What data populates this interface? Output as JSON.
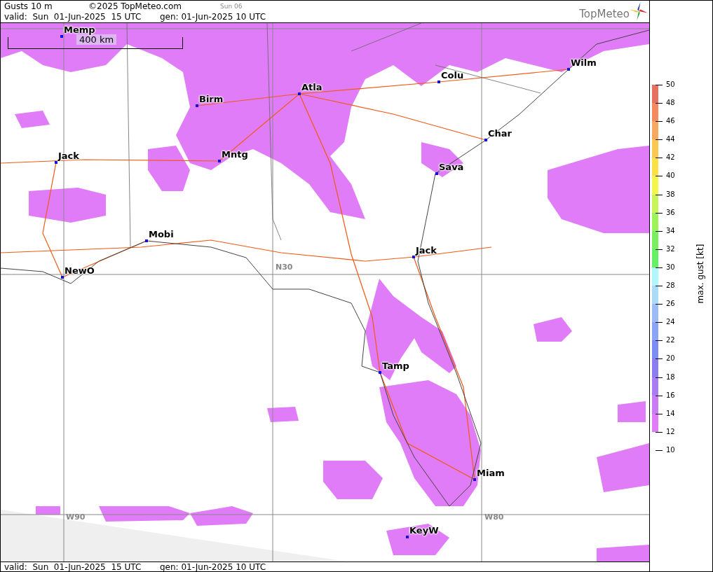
{
  "header": {
    "title": "Gusts 10 m",
    "copyright": "©2025 TopMeteo.com",
    "day": "Sun 06",
    "valid": "valid:  Sun  01-Jun-2025  15 UTC",
    "generated": "gen: 01-Jun-2025 10 UTC",
    "logo": "TopMeteo"
  },
  "map": {
    "scale": "400 km",
    "grid_labels": [
      "N30",
      "W90",
      "W80"
    ],
    "cities": [
      {
        "label": "Memp"
      },
      {
        "label": "Birm"
      },
      {
        "label": "Atla"
      },
      {
        "label": "Colu"
      },
      {
        "label": "Wilm"
      },
      {
        "label": "Char"
      },
      {
        "label": "Mntg"
      },
      {
        "label": "Jack"
      },
      {
        "label": "Sava"
      },
      {
        "label": "Mobi"
      },
      {
        "label": "Jack"
      },
      {
        "label": "NewO"
      },
      {
        "label": "Tamp"
      },
      {
        "label": "Miam"
      },
      {
        "label": "KeyW"
      }
    ]
  },
  "footer": {
    "valid": "valid:  Sun  01-Jun-2025  15 UTC",
    "generated": "gen: 01-Jun-2025 10 UTC"
  },
  "legend": {
    "title": "max. gust [kt]",
    "ticks": [
      "50",
      "48",
      "46",
      "44",
      "42",
      "40",
      "38",
      "36",
      "34",
      "32",
      "30",
      "28",
      "26",
      "24",
      "22",
      "20",
      "18",
      "16",
      "14",
      "12",
      "10"
    ],
    "bands": [
      {
        "color": "#e87060"
      },
      {
        "color": "#f58a60"
      },
      {
        "color": "#f8a860"
      },
      {
        "color": "#fbc850"
      },
      {
        "color": "#fbe048"
      },
      {
        "color": "#f5f550"
      },
      {
        "color": "#c8f55a"
      },
      {
        "color": "#9ef25a"
      },
      {
        "color": "#7af060"
      },
      {
        "color": "#66f066"
      },
      {
        "color": "#b0f8fb"
      },
      {
        "color": "#a8dcf9"
      },
      {
        "color": "#9dbcf7"
      },
      {
        "color": "#8aa5f6"
      },
      {
        "color": "#7c8cf4"
      },
      {
        "color": "#8c7cf2"
      },
      {
        "color": "#a97cf3"
      },
      {
        "color": "#c97cf5"
      },
      {
        "color": "#e07cf7"
      }
    ]
  }
}
